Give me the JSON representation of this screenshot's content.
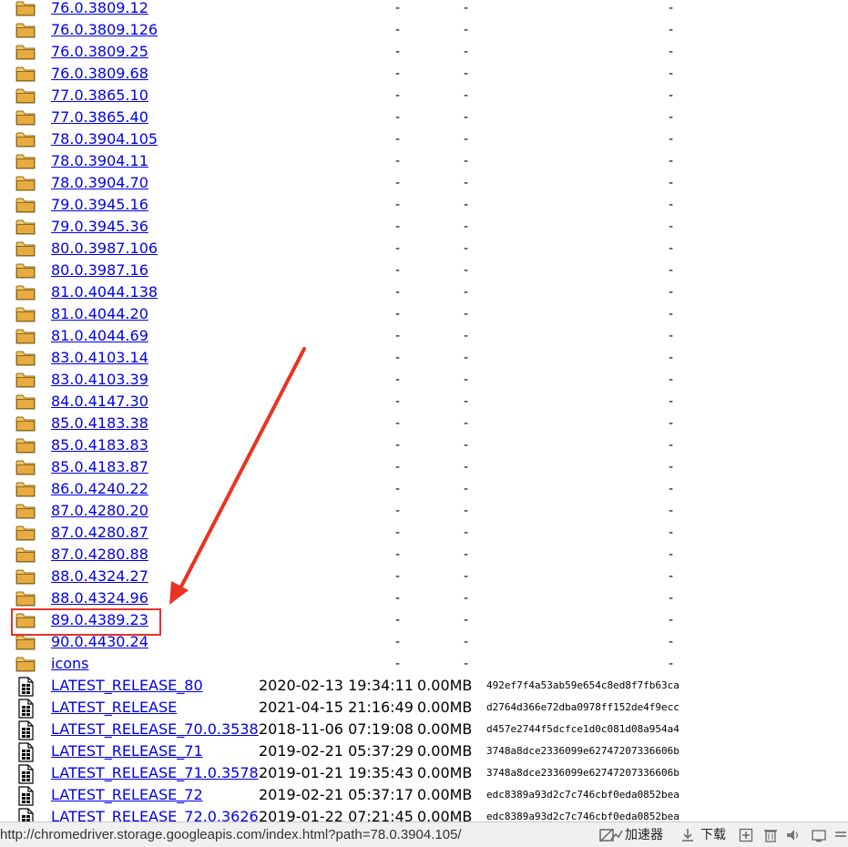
{
  "colors": {
    "link": "#0000ee",
    "highlight": "#e8302a",
    "arrow": "#ea3323",
    "folder": "#f5c45c"
  },
  "directory": {
    "folders": [
      "76.0.3809.12",
      "76.0.3809.126",
      "76.0.3809.25",
      "76.0.3809.68",
      "77.0.3865.10",
      "77.0.3865.40",
      "78.0.3904.105",
      "78.0.3904.11",
      "78.0.3904.70",
      "79.0.3945.16",
      "79.0.3945.36",
      "80.0.3987.106",
      "80.0.3987.16",
      "81.0.4044.138",
      "81.0.4044.20",
      "81.0.4044.69",
      "83.0.4103.14",
      "83.0.4103.39",
      "84.0.4147.30",
      "85.0.4183.38",
      "85.0.4183.83",
      "85.0.4183.87",
      "86.0.4240.22",
      "87.0.4280.20",
      "87.0.4280.87",
      "87.0.4280.88",
      "88.0.4324.27",
      "88.0.4324.96",
      "89.0.4389.23",
      "90.0.4430.24",
      "icons"
    ],
    "empty_marker": "-",
    "highlighted_folder": "89.0.4389.23",
    "files": [
      {
        "name": "LATEST_RELEASE_80",
        "date": "2020-02-13 19:34:11",
        "size": "0.00MB",
        "hash": "492ef7f4a53ab59e654c8ed8f7fb63ca"
      },
      {
        "name": "LATEST_RELEASE",
        "date": "2021-04-15 21:16:49",
        "size": "0.00MB",
        "hash": "d2764d366e72dba0978ff152de4f9ecc"
      },
      {
        "name": "LATEST_RELEASE_70.0.3538",
        "date": "2018-11-06 07:19:08",
        "size": "0.00MB",
        "hash": "d457e2744f5dcfce1d0c081d08a954a4"
      },
      {
        "name": "LATEST_RELEASE_71",
        "date": "2019-02-21 05:37:29",
        "size": "0.00MB",
        "hash": "3748a8dce2336099e62747207336606b"
      },
      {
        "name": "LATEST_RELEASE_71.0.3578",
        "date": "2019-01-21 19:35:43",
        "size": "0.00MB",
        "hash": "3748a8dce2336099e62747207336606b"
      },
      {
        "name": "LATEST_RELEASE_72",
        "date": "2019-02-21 05:37:17",
        "size": "0.00MB",
        "hash": "edc8389a93d2c7c746cbf0eda0852bea"
      },
      {
        "name": "LATEST_RELEASE_72.0.3626",
        "date": "2019-01-22 07:21:45",
        "size": "0.00MB",
        "hash": "edc8389a93d2c7c746cbf0eda0852bea"
      }
    ]
  },
  "statusbar": {
    "url": "http://chromedriver.storage.googleapis.com/index.html?path=78.0.3904.105/",
    "accelerator_label": "加速器",
    "download_label": "下载",
    "icons": [
      "no-image-icon",
      "accelerator-icon",
      "download-icon",
      "add-icon",
      "trash-icon",
      "speaker-icon",
      "screen-icon"
    ]
  }
}
